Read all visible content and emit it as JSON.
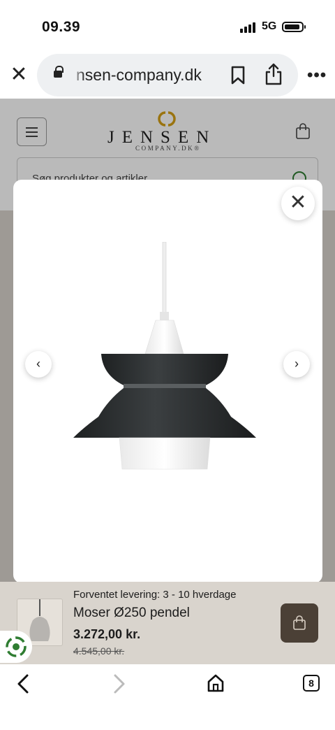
{
  "status_bar": {
    "time": "09.39",
    "network": "5G"
  },
  "browser": {
    "url_visible": "nsen-company.dk",
    "tab_count": "8"
  },
  "site": {
    "logo_name": "JENSEN",
    "logo_sub": "COMPANY.DK®",
    "search_placeholder": "Søg produkter og artikler"
  },
  "modal": {
    "close_symbol": "✕",
    "prev_symbol": "‹",
    "next_symbol": "›"
  },
  "product": {
    "delivery": "Forventet levering: 3 - 10 hverdage",
    "name": "Moser Ø250 pendel",
    "price": "3.272,00 kr.",
    "old_price": "4.545,00 kr."
  },
  "colors": {
    "brand_gold": "#d4a017",
    "cart_button": "#4b4036",
    "lamp_shade": "#2a2d2e",
    "eco_green": "#2f7d32"
  }
}
